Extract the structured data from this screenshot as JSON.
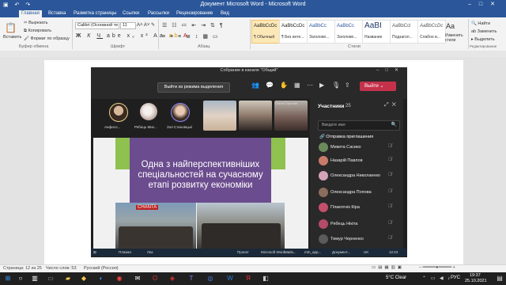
{
  "word": {
    "title": "Документ Microsoft Word - Microsoft Word",
    "tabs": [
      "Главная",
      "Вставка",
      "Разметка страницы",
      "Ссылки",
      "Рассылки",
      "Рецензирование",
      "Вид"
    ],
    "clipboard": {
      "paste": "Вставить",
      "cut": "Вырезать",
      "copy": "Копировать",
      "format": "Формат по образцу",
      "label": "Буфер обмена"
    },
    "font": {
      "name": "Calibri (Основной те",
      "size": "11",
      "label": "Шрифт"
    },
    "paragraph_label": "Абзац",
    "styles": [
      {
        "sample": "AaBbCcDc",
        "name": "¶ Обычный"
      },
      {
        "sample": "AaBbCcDc",
        "name": "¶ Без инте..."
      },
      {
        "sample": "AaBbCc",
        "name": "Заголово..."
      },
      {
        "sample": "AaBbCc",
        "name": "Заголово..."
      },
      {
        "sample": "АаВI",
        "name": "Название"
      },
      {
        "sample": "AaBbCcl",
        "name": "Подзагол..."
      },
      {
        "sample": "AaBbCcDc",
        "name": "Слабое в..."
      }
    ],
    "styles_label": "Стили",
    "change_styles": "Изменить стили",
    "editing": {
      "find": "Найти",
      "replace": "Заменить",
      "select": "Выделить",
      "label": "Редактирование"
    },
    "status": {
      "page": "Страница: 12 из 25",
      "words": "Число слов: 53",
      "lang": "Русский (Россия)"
    }
  },
  "teams": {
    "title": "Собрание в канале \"Общий\"",
    "exit_focus": "Выйти из режима выделения",
    "leave": "Выйти",
    "strip_people": [
      "Анфисо...",
      "Рябець Мих...",
      "Зоя Становцькi"
    ],
    "tile_label": "Ольга Сорочан",
    "slide_text": "Одна з найперспективніших спеціальностей на сучасному етапі розвитку економіки",
    "photo_sign": "CHANTA",
    "panel": {
      "title": "Участники",
      "count": "25",
      "invite_placeholder": "Введите имя",
      "share_invite": "Отправка приглашения",
      "participants": [
        "Микита Сасико",
        "Назарій Павлов",
        "Олександра Николаенко",
        "Олександра Попова",
        "Плакотнік Кіра",
        "Рябець Нікіта",
        "Тимур Черненко"
      ]
    },
    "inner_taskbar": [
      "Плазмо",
      "Лаз",
      "Проект",
      "Microsoft Word...",
      "Майк...",
      "mtn_app...",
      "Документ..."
    ],
    "inner_time": "12:24",
    "inner_lang": "UK"
  },
  "taskbar": {
    "weather": "5°C  Clear",
    "lang": "РУС",
    "time": "19:37",
    "date": "25.10.2021"
  }
}
